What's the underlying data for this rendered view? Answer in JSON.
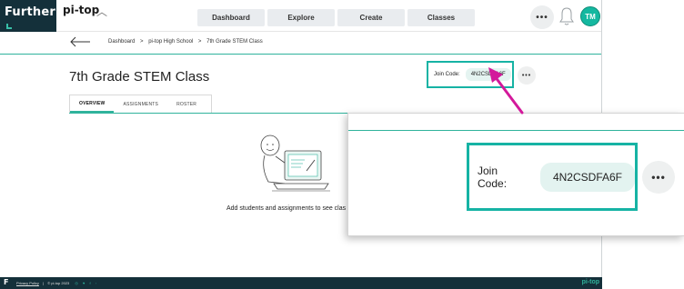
{
  "brand": {
    "name": "Further"
  },
  "topbar": {
    "logo": "pi-top",
    "nav": [
      "Dashboard",
      "Explore",
      "Create",
      "Classes"
    ],
    "more": "•••",
    "avatar": "TM"
  },
  "breadcrumb": [
    "Dashboard",
    "pi-top High School",
    "7th Grade STEM Class"
  ],
  "breadcrumb_separator": ">",
  "page": {
    "title": "7th Grade STEM Class",
    "join_label": "Join Code:",
    "join_code": "4N2CSDFA6F",
    "more": "•••"
  },
  "tabs": [
    "OVERVIEW",
    "ASSIGNMENTS",
    "ROSTER"
  ],
  "empty_message": "Add students and assignments to see clas",
  "footer": {
    "brand": "F",
    "privacy": "Privacy Policy",
    "separator": "|",
    "copyright": "© pi-top 2023",
    "social": "◎ ♥ f ◦",
    "logo": "pi-top"
  },
  "zoom": {
    "join_label": "Join Code:",
    "join_code": "4N2CSDFA6F",
    "more": "•••"
  },
  "colors": {
    "brand_dark": "#14303a",
    "accent_teal": "#16b3a4",
    "avatar": "#14b8a0",
    "pointer": "#d3199b"
  }
}
